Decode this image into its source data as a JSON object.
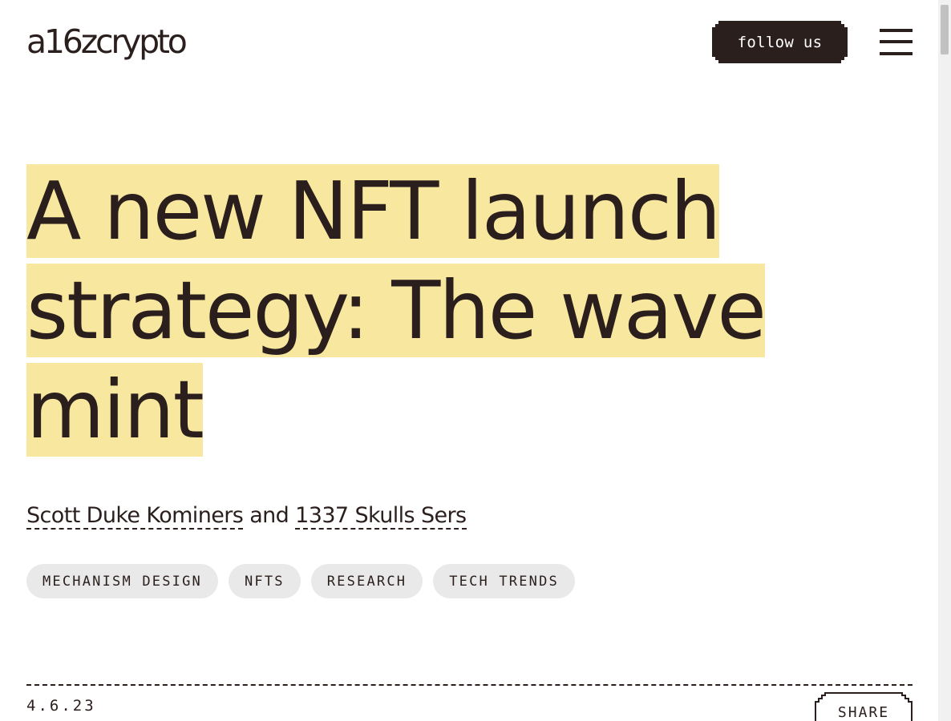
{
  "header": {
    "logo_text": "a16zcrypto",
    "follow_label": "follow us",
    "menu_icon": "hamburger-menu-icon"
  },
  "article": {
    "title": "A new NFT launch strategy: The wave mint",
    "authors": [
      {
        "name": "Scott Duke Kominers"
      },
      {
        "name": "1337 Skulls Sers"
      }
    ],
    "author_joiner": "and",
    "tags": [
      "MECHANISM DESIGN",
      "NFTS",
      "RESEARCH",
      "TECH TRENDS"
    ],
    "date": "4.6.23",
    "share_label": "SHARE"
  },
  "colors": {
    "text": "#2a1f1d",
    "title_highlight": "#f8e89f",
    "tag_background": "#e9e9e9",
    "button_background": "#2a1f1d"
  }
}
